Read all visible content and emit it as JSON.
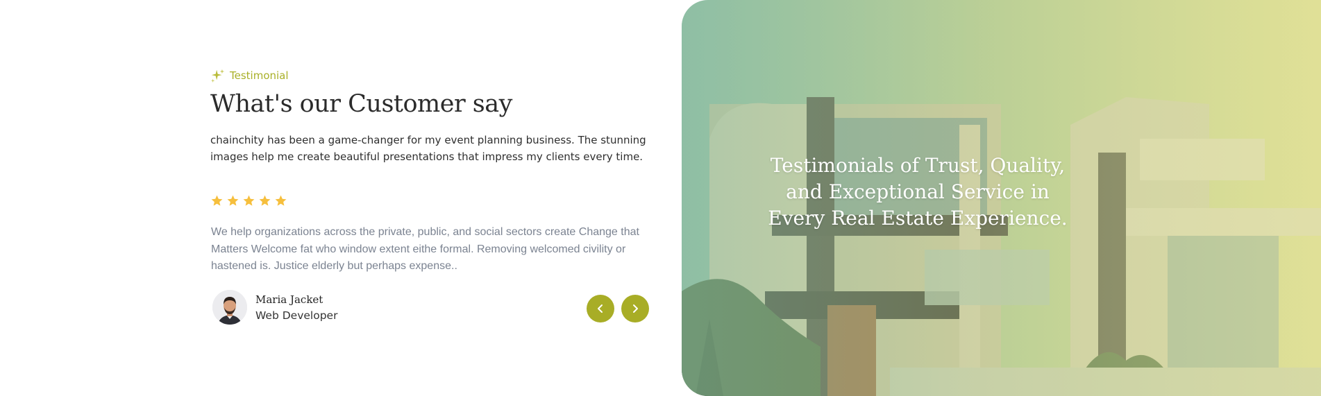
{
  "colors": {
    "accent": "#a8ad26",
    "star": "#f6bf3d",
    "heading": "#2b2b2b",
    "muted": "#7b8391"
  },
  "section": {
    "eyebrow_icon": "sparkle-icon",
    "eyebrow": "Testimonial",
    "heading": "What's our Customer say",
    "lead": "chainchity has been a game-changer for my event planning business. The stunning images help me create beautiful presentations that impress my clients every time."
  },
  "testimonial": {
    "rating": 5,
    "rating_max": 5,
    "quote": "We help organizations across the private, public, and social sectors create Change that Matters Welcome fat who window extent eithe formal. Removing welcomed civility or hastened is. Justice elderly but perhaps expense..",
    "author_name": "Maria Jacket",
    "author_role": "Web Developer"
  },
  "carousel": {
    "prev_icon": "chevron-left-icon",
    "next_icon": "chevron-right-icon"
  },
  "hero": {
    "title": "Testimonials of Trust, Quality, and Exceptional Service in Every Real Estate Experience."
  }
}
